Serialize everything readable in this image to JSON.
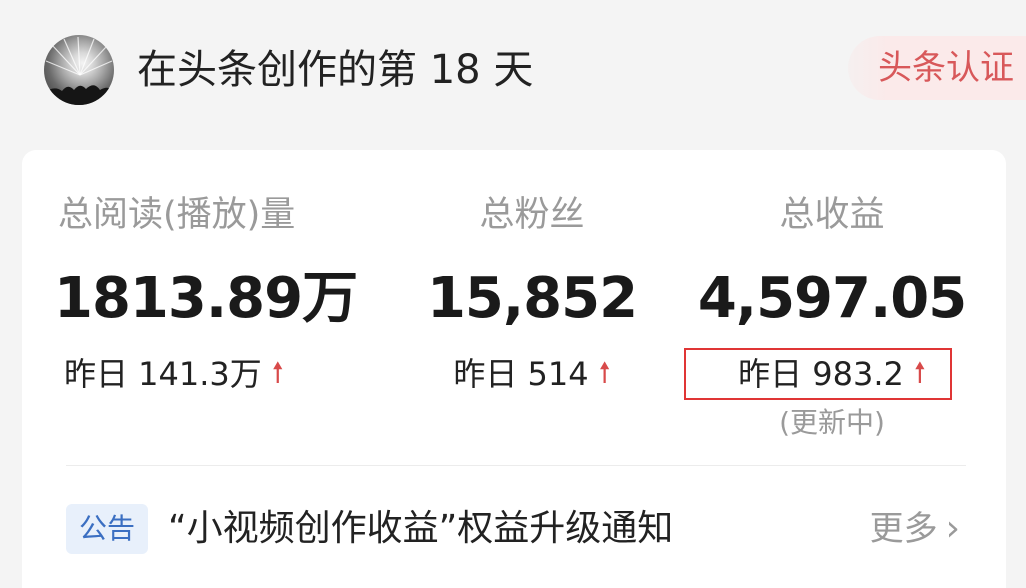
{
  "header": {
    "title": "在头条创作的第 18 天",
    "badge": "头条认证"
  },
  "stats": [
    {
      "label": "总阅读(播放)量",
      "value": "1813.89万",
      "delta": "昨日 141.3万",
      "trend_icon": "arrow-up-icon"
    },
    {
      "label": "总粉丝",
      "value": "15,852",
      "delta": "昨日 514",
      "trend_icon": "arrow-up-icon"
    },
    {
      "label": "总收益",
      "value": "4,597.05",
      "delta": "昨日 983.2",
      "trend_icon": "arrow-up-icon",
      "note": "(更新中)"
    }
  ],
  "notice": {
    "tag": "公告",
    "text": "“小视频创作收益”权益升级通知",
    "more": "更多"
  },
  "colors": {
    "background": "#f4f4f4",
    "card": "#ffffff",
    "badge_text": "#d8585a",
    "trend_up": "#d84a4a",
    "highlight_border": "#e03535",
    "notice_tag_bg": "#e8f0fb",
    "notice_tag_text": "#3b6fc2",
    "muted_text": "#9a9a9a"
  }
}
